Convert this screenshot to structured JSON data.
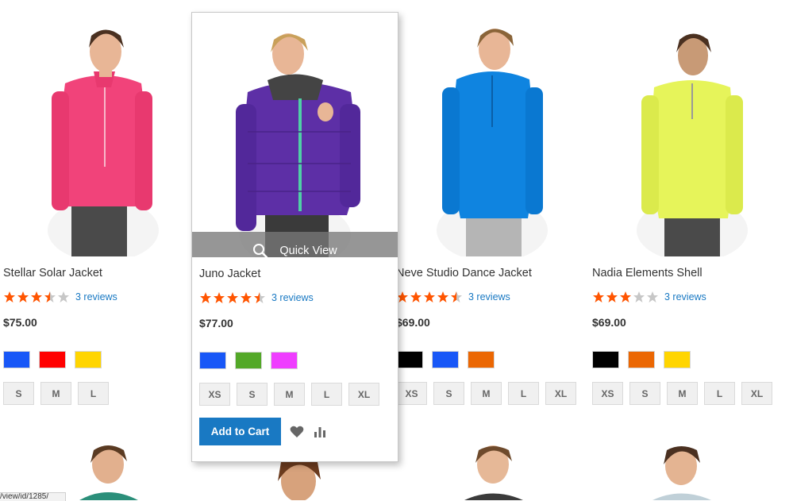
{
  "colors": {
    "link": "#1979c3",
    "star_filled": "#ff5501",
    "star_empty": "#c7c7c7",
    "button": "#1979c3"
  },
  "quick_view_label": "Quick View",
  "add_to_cart_label": "Add to Cart",
  "status_url": "/view/id/1285/",
  "products": [
    {
      "name": "Stellar Solar Jacket",
      "rating_stars": 3.5,
      "reviews": "3 reviews",
      "price": "$75.00",
      "colors": [
        "#1857f7",
        "#ff0000",
        "#ffd500"
      ],
      "sizes": [
        "S",
        "M",
        "L"
      ],
      "jacket_color": "#f1437a"
    },
    {
      "name": "Juno Jacket",
      "rating_stars": 4.5,
      "reviews": "3 reviews",
      "price": "$77.00",
      "colors": [
        "#1857f7",
        "#53a828",
        "#ef3dff"
      ],
      "sizes": [
        "XS",
        "S",
        "M",
        "L",
        "XL"
      ],
      "jacket_color": "#5d2fa6"
    },
    {
      "name": "Neve Studio Dance Jacket",
      "rating_stars": 4.5,
      "reviews": "3 reviews",
      "price": "$69.00",
      "colors": [
        "#000000",
        "#1857f7",
        "#eb6703"
      ],
      "sizes": [
        "XS",
        "S",
        "M",
        "L",
        "XL"
      ],
      "jacket_color": "#0f84e0"
    },
    {
      "name": "Nadia Elements Shell",
      "rating_stars": 3,
      "reviews": "3 reviews",
      "price": "$69.00",
      "colors": [
        "#000000",
        "#eb6703",
        "#ffd500"
      ],
      "sizes": [
        "XS",
        "S",
        "M",
        "L",
        "XL"
      ],
      "jacket_color": "#e6f45a"
    }
  ]
}
